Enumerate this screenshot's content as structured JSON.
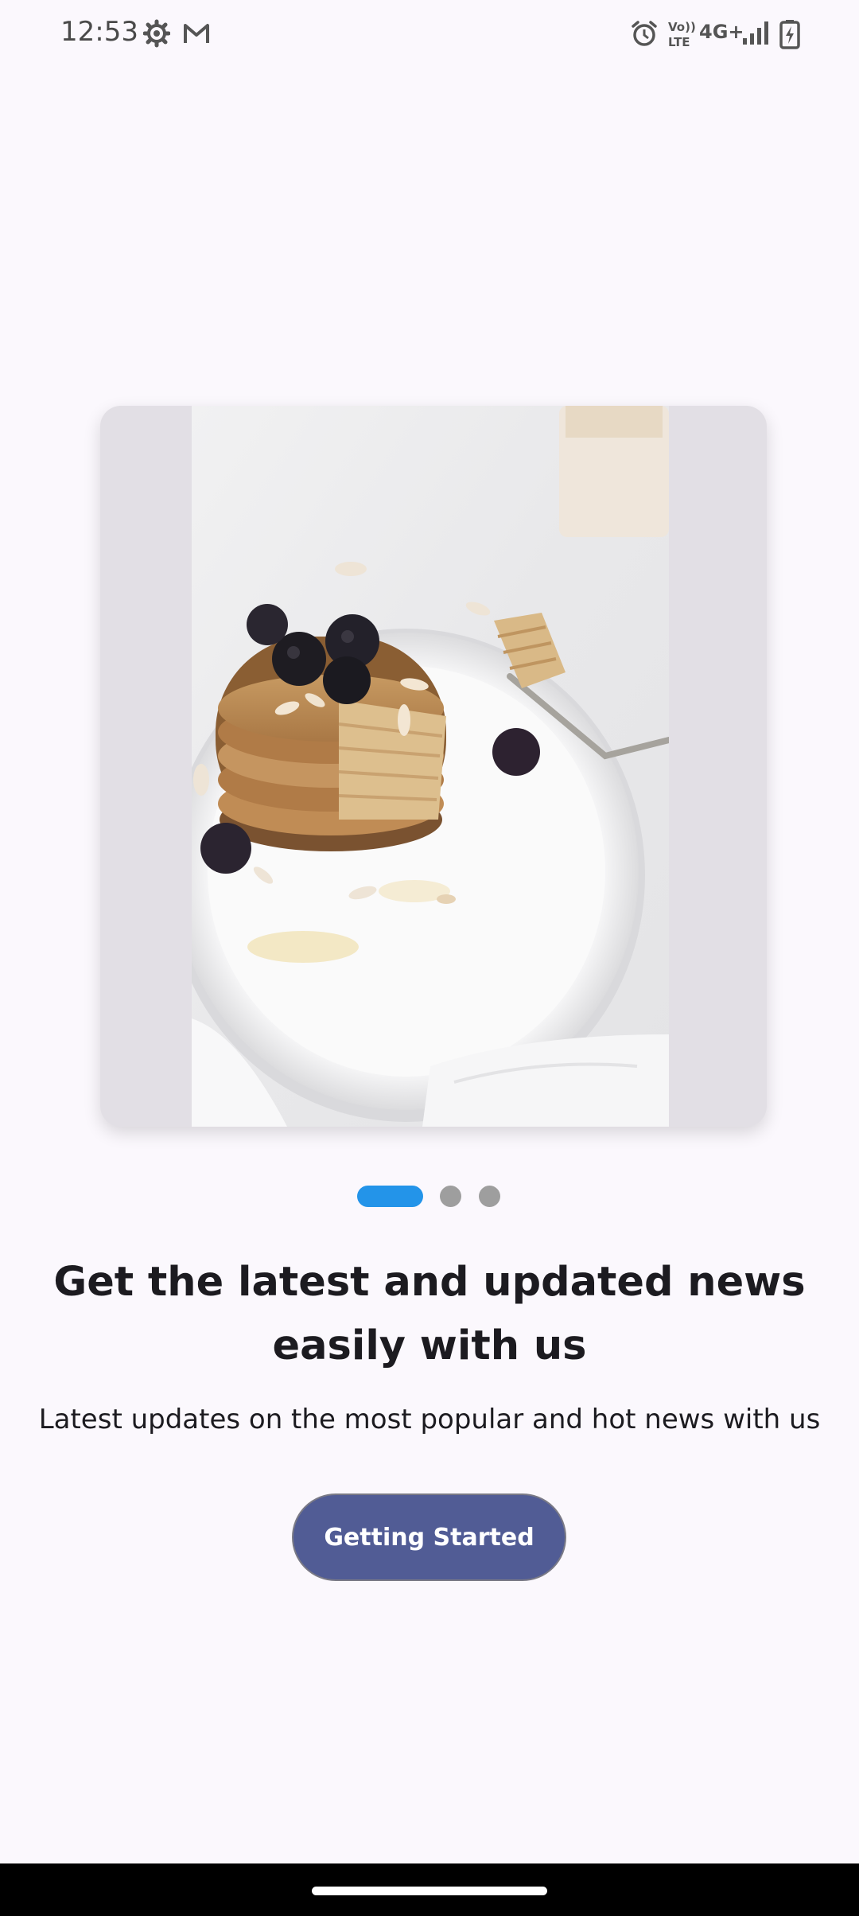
{
  "status_bar": {
    "time": "12:53",
    "left_icons": [
      "settings-gear-icon",
      "gmail-icon"
    ],
    "right_icons": [
      "alarm-icon",
      "volte-icon",
      "network-4g-plus-icon",
      "signal-icon",
      "battery-charging-icon"
    ],
    "volte_label_top": "Vo))",
    "volte_label_bottom": "LTE",
    "network_label": "4G+"
  },
  "carousel": {
    "image_subject": "stack of pancakes with blackberries and almonds on a white plate",
    "pages": 3,
    "active_page": 1
  },
  "onboarding": {
    "headline": "Get the latest and updated news easily with us",
    "subtext": "Latest updates on the most popular and hot news with us",
    "cta_label": "Getting Started"
  },
  "colors": {
    "background": "#fbf8fd",
    "indicator_active": "#2394e9",
    "indicator_inactive": "#9e9e9e",
    "button": "#515c95",
    "text": "#1c1b20"
  }
}
